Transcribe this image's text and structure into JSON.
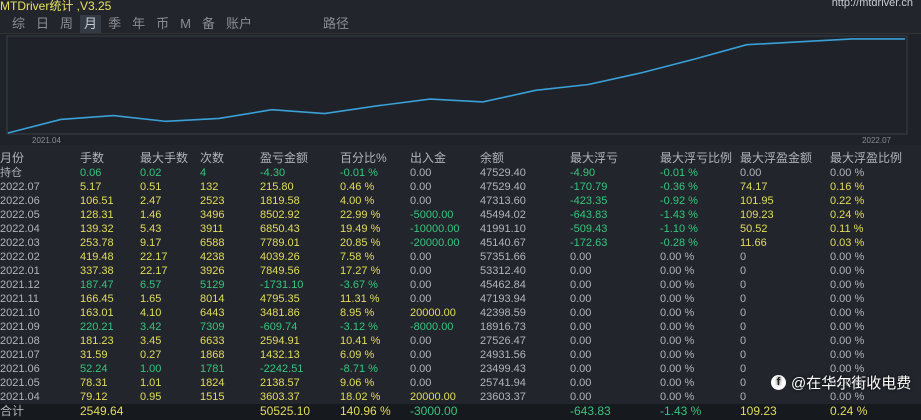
{
  "app": {
    "title": "MTDriver统计 ,V3.25",
    "url": "http://mtdriver.cn"
  },
  "tabs": [
    {
      "label": "综"
    },
    {
      "label": "日"
    },
    {
      "label": "周"
    },
    {
      "label": "月",
      "active": true
    },
    {
      "label": "季"
    },
    {
      "label": "年"
    },
    {
      "label": "币"
    },
    {
      "label": "M"
    },
    {
      "label": "备"
    },
    {
      "label": "账户"
    },
    {
      "label": "路径"
    }
  ],
  "chart_data": {
    "type": "line",
    "x_start_label": "2021.04",
    "x_end_label": "2022.07",
    "ylim": [
      0,
      100
    ],
    "values": [
      0,
      14,
      18,
      12,
      15,
      24,
      20,
      28,
      35,
      32,
      44,
      50,
      62,
      76,
      91,
      94,
      97,
      97
    ]
  },
  "columns": [
    "月份",
    "手数",
    "最大手数",
    "次数",
    "盈亏金额",
    "百分比%",
    "出入金",
    "余额",
    "最大浮亏",
    "最大浮亏比例",
    "最大浮盈金额",
    "最大浮盈比例"
  ],
  "rows": [
    [
      "持仓",
      "0.06",
      "0.02",
      "4",
      "-4.30",
      "-0.01 %",
      "0.00",
      "47529.40",
      "-4.90",
      "-0.01 %",
      "0.00",
      "0.00 %"
    ],
    [
      "2022.07",
      "5.17",
      "0.51",
      "132",
      "215.80",
      "0.46 %",
      "0.00",
      "47529.40",
      "-170.79",
      "-0.36 %",
      "74.17",
      "0.16 %"
    ],
    [
      "2022.06",
      "106.51",
      "2.47",
      "2523",
      "1819.58",
      "4.00 %",
      "0.00",
      "47313.60",
      "-423.35",
      "-0.92 %",
      "101.95",
      "0.22 %"
    ],
    [
      "2022.05",
      "128.31",
      "1.46",
      "3496",
      "8502.92",
      "22.99 %",
      "-5000.00",
      "45494.02",
      "-643.83",
      "-1.43 %",
      "109.23",
      "0.24 %"
    ],
    [
      "2022.04",
      "139.32",
      "5.43",
      "3911",
      "6850.43",
      "19.49 %",
      "-10000.00",
      "41991.10",
      "-509.43",
      "-1.10 %",
      "50.52",
      "0.11 %"
    ],
    [
      "2022.03",
      "253.78",
      "9.17",
      "6588",
      "7789.01",
      "20.85 %",
      "-20000.00",
      "45140.67",
      "-172.63",
      "-0.28 %",
      "11.66",
      "0.03 %"
    ],
    [
      "2022.02",
      "419.48",
      "22.17",
      "4238",
      "4039.26",
      "7.58 %",
      "0.00",
      "57351.66",
      "0.00",
      "0.00 %",
      "0",
      "0.00 %"
    ],
    [
      "2022.01",
      "337.38",
      "22.17",
      "3926",
      "7849.56",
      "17.27 %",
      "0.00",
      "53312.40",
      "0.00",
      "0.00 %",
      "0",
      "0.00 %"
    ],
    [
      "2021.12",
      "187.47",
      "6.57",
      "5129",
      "-1731.10",
      "-3.67 %",
      "0.00",
      "45462.84",
      "0.00",
      "0.00 %",
      "0",
      "0.00 %"
    ],
    [
      "2021.11",
      "166.45",
      "1.65",
      "8014",
      "4795.35",
      "11.31 %",
      "0.00",
      "47193.94",
      "0.00",
      "0.00 %",
      "0",
      "0.00 %"
    ],
    [
      "2021.10",
      "163.01",
      "4.10",
      "6443",
      "3481.86",
      "8.95 %",
      "20000.00",
      "42398.59",
      "0.00",
      "0.00 %",
      "0",
      "0.00 %"
    ],
    [
      "2021.09",
      "220.21",
      "3.42",
      "7309",
      "-609.74",
      "-3.12 %",
      "-8000.00",
      "18916.73",
      "0.00",
      "0.00 %",
      "0",
      "0.00 %"
    ],
    [
      "2021.08",
      "181.23",
      "3.45",
      "6633",
      "2594.91",
      "10.41 %",
      "0.00",
      "27526.47",
      "0.00",
      "0.00 %",
      "0",
      "0.00 %"
    ],
    [
      "2021.07",
      "31.59",
      "0.27",
      "1868",
      "1432.13",
      "6.09 %",
      "0.00",
      "24931.56",
      "0.00",
      "0.00 %",
      "0",
      "0.00 %"
    ],
    [
      "2021.06",
      "52.24",
      "1.00",
      "1781",
      "-2242.51",
      "-8.71 %",
      "0.00",
      "23499.43",
      "0.00",
      "0.00 %",
      "0",
      "0.00 %"
    ],
    [
      "2021.05",
      "78.31",
      "1.01",
      "1824",
      "2138.57",
      "9.06 %",
      "0.00",
      "25741.94",
      "0.00",
      "0.00 %",
      "0",
      "0.00 %"
    ],
    [
      "2021.04",
      "79.12",
      "0.95",
      "1515",
      "3603.37",
      "18.02 %",
      "20000.00",
      "23603.37",
      "0.00",
      "0.00 %",
      "0",
      "0.00 %"
    ]
  ],
  "total": [
    "合计",
    "2549.64",
    "",
    "",
    "50525.10",
    "140.96 %",
    "-3000.00",
    "",
    "-643.83",
    "-1.43 %",
    "109.23",
    "0.24 %"
  ],
  "watermark": "@在华尔街收电费"
}
